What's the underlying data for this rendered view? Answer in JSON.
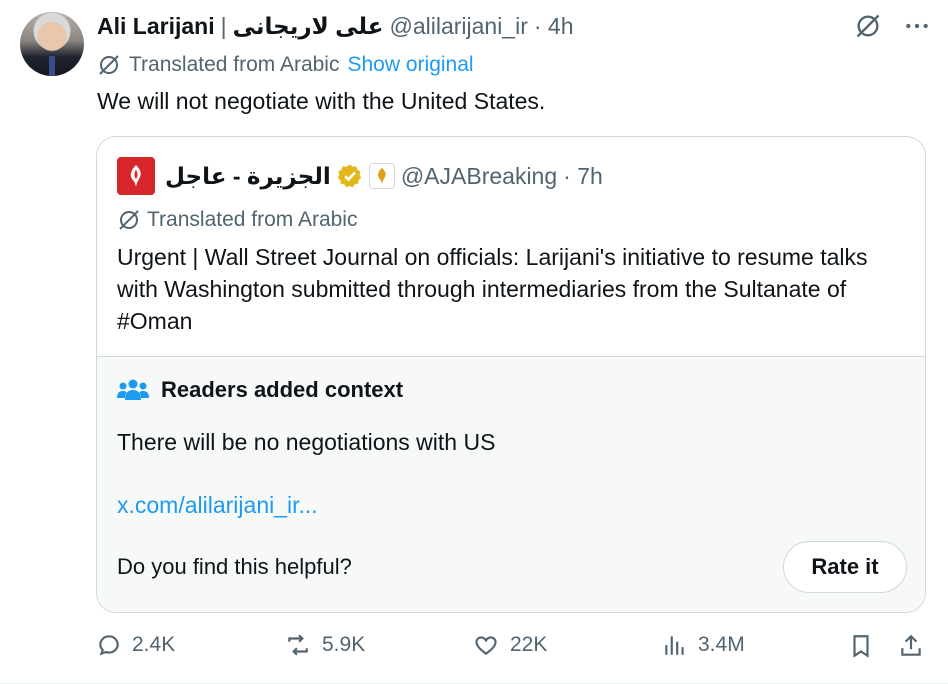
{
  "author": {
    "name": "Ali Larijani",
    "name_arabic": "علی لاریجانی",
    "separator": "|",
    "handle": "@alilarijani_ir",
    "time": "· 4h"
  },
  "translation": {
    "label": "Translated from Arabic",
    "show_original": "Show original"
  },
  "tweet_text": "We will not negotiate with the United States.",
  "quote": {
    "name": "الجزيرة - عاجل",
    "handle": "@AJABreaking",
    "time": "· 7h",
    "translated_label": "Translated from Arabic",
    "text": "Urgent | Wall Street Journal on officials: Larijani's initiative to resume talks with Washington submitted through intermediaries from the Sultanate of #Oman"
  },
  "context": {
    "title": "Readers added context",
    "text": "There will be no negotiations with US",
    "link": "x.com/alilarijani_ir...",
    "helpful_question": "Do you find this helpful?",
    "rate_button": "Rate it"
  },
  "actions": {
    "replies": "2.4K",
    "reposts": "5.9K",
    "likes": "22K",
    "views": "3.4M"
  },
  "colors": {
    "accent": "#1d9bf0",
    "muted": "#536471",
    "verified": "#e2b719",
    "aljazeera_red": "#d7262b"
  }
}
